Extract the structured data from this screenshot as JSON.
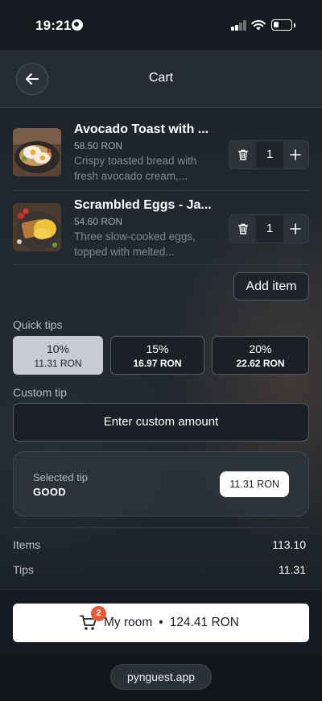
{
  "status_bar": {
    "time": "19:21"
  },
  "header": {
    "title": "Cart"
  },
  "cart": {
    "items": [
      {
        "name": "Avocado Toast with ...",
        "price": "58.50 RON",
        "description": "Crispy toasted bread with fresh avocado cream,...",
        "quantity": "1"
      },
      {
        "name": "Scrambled Eggs - Ja...",
        "price": "54.60 RON",
        "description": "Three slow-cooked eggs, topped with melted...",
        "quantity": "1"
      }
    ],
    "add_item_label": "Add item"
  },
  "tips": {
    "quick_label": "Quick tips",
    "options": [
      {
        "percent": "10%",
        "amount": "11.31 RON",
        "selected": true
      },
      {
        "percent": "15%",
        "amount": "16.97 RON",
        "selected": false
      },
      {
        "percent": "20%",
        "amount": "22.62 RON",
        "selected": false
      }
    ],
    "custom_label": "Custom tip",
    "custom_button": "Enter custom amount",
    "selected_label": "Selected tip",
    "selected_value": "GOOD",
    "selected_amount": "11.31 RON"
  },
  "summary": {
    "items_label": "Items",
    "items_value": "113.10",
    "tips_label": "Tips",
    "tips_value": "11.31"
  },
  "checkout": {
    "badge_count": "2",
    "label": "My room",
    "separator": "•",
    "total": "124.41 RON"
  },
  "footer": {
    "domain": "pynguest.app"
  },
  "icons": {
    "back": "arrow-left-icon",
    "trash": "trash-icon",
    "plus": "plus-icon",
    "cart": "shopping-cart-icon"
  },
  "colors": {
    "background": "#1d2229",
    "selected_tip": "#c7ccd3",
    "badge": "#ea5a3a"
  }
}
